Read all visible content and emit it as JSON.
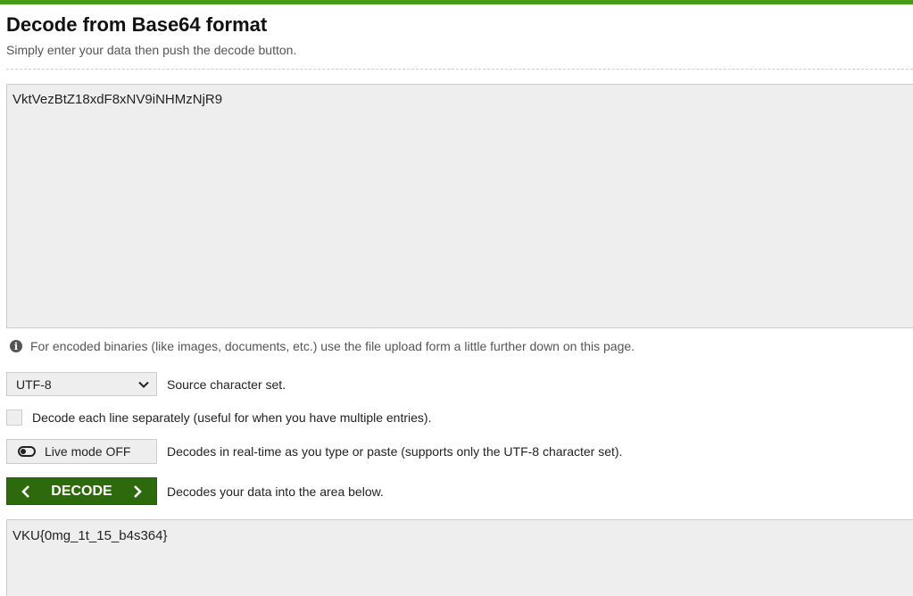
{
  "header": {
    "title": "Decode from Base64 format",
    "subtitle": "Simply enter your data then push the decode button.",
    "accent_color": "#4c9a1a"
  },
  "input": {
    "value": "VktVezBtZ18xdF8xNV9iNHMzNjR9"
  },
  "info": {
    "icon": "info-icon",
    "text": "For encoded binaries (like images, documents, etc.) use the file upload form a little further down on this page."
  },
  "charset": {
    "selected": "UTF-8",
    "label": "Source character set."
  },
  "line_option": {
    "checked": false,
    "label": "Decode each line separately (useful for when you have multiple entries)."
  },
  "live_mode": {
    "button_label": "Live mode OFF",
    "description": "Decodes in real-time as you type or paste (supports only the UTF-8 character set)."
  },
  "decode": {
    "button_label": "DECODE",
    "description": "Decodes your data into the area below.",
    "button_color": "#2d6a0e"
  },
  "output": {
    "value": "VKU{0mg_1t_15_b4s364}"
  }
}
